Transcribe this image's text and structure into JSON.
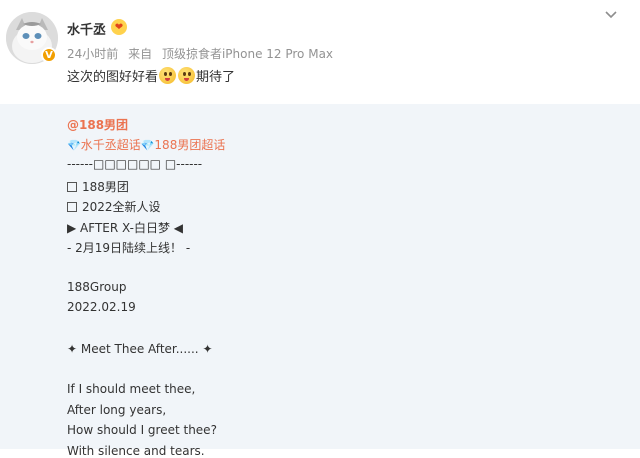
{
  "post": {
    "username": "水千丞",
    "badge_icon": "heart-badge-icon",
    "meta": {
      "time": "24小时前",
      "source_prefix": "来自",
      "source": "顶级掠食者iPhone 12 Pro Max"
    },
    "text_before": "这次的图好好看",
    "text_after": "期待了",
    "emoji_icons": [
      "drooling-face-icon",
      "drooling-face-icon"
    ]
  },
  "repost": {
    "mention": "@188男团",
    "topics": [
      "水千丞超话",
      "188男团超话"
    ],
    "lines": [
      "------□□□□□□ □------",
      "188男团",
      "2022全新人设",
      "▶ AFTER X-白日梦 ◀",
      "- 2月19日陆续上线！ -",
      "",
      "188Group",
      "2022.02.19",
      "",
      "✦ Meet Thee After...... ✦",
      "",
      "If I should meet thee,",
      "After long years,",
      "How should I greet thee?",
      "With silence and tears."
    ]
  },
  "colors": {
    "accent": "#eb7350",
    "repost_bg": "#f1f5f9",
    "meta_text": "#939393",
    "verified": "#f29f00"
  }
}
